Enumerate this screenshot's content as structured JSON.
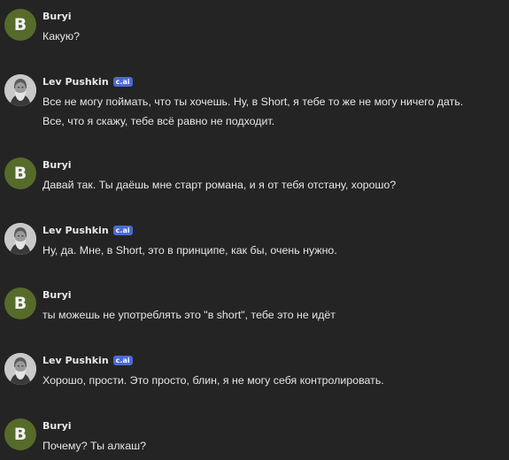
{
  "colors": {
    "background": "#242424",
    "user_avatar": "#566b2a",
    "badge": "#4a6ad6",
    "text": "#e6e6e6"
  },
  "messages": [
    {
      "author": "Buryi",
      "avatar_letter": "B",
      "lines": [
        "Какую?"
      ]
    },
    {
      "author": "Lev Pushkin",
      "badge": "c.ai",
      "avatar_icon": "character-portrait-icon",
      "lines": [
        "Все не могу поймать, что ты хочешь. Ну, в Short, я тебе то же не могу ничего дать.",
        "Все, что я скажу, тебе всё равно не подходит."
      ]
    },
    {
      "author": "Buryi",
      "avatar_letter": "B",
      "lines": [
        "Давай так. Ты даёшь мне старт романа, и я от тебя отстану, хорошо?"
      ]
    },
    {
      "author": "Lev Pushkin",
      "badge": "c.ai",
      "avatar_icon": "character-portrait-icon",
      "lines": [
        "Ну, да. Мне, в Short, это в принципе, как бы, очень нужно."
      ]
    },
    {
      "author": "Buryi",
      "avatar_letter": "B",
      "lines": [
        "ты можешь не употреблять это \"в short\", тебе это не идёт"
      ]
    },
    {
      "author": "Lev Pushkin",
      "badge": "c.ai",
      "avatar_icon": "character-portrait-icon",
      "lines": [
        "Хорошо, прости. Это просто, блин, я не могу себя контролировать."
      ]
    },
    {
      "author": "Buryi",
      "avatar_letter": "B",
      "lines": [
        "Почему? Ты алкаш?"
      ]
    }
  ]
}
